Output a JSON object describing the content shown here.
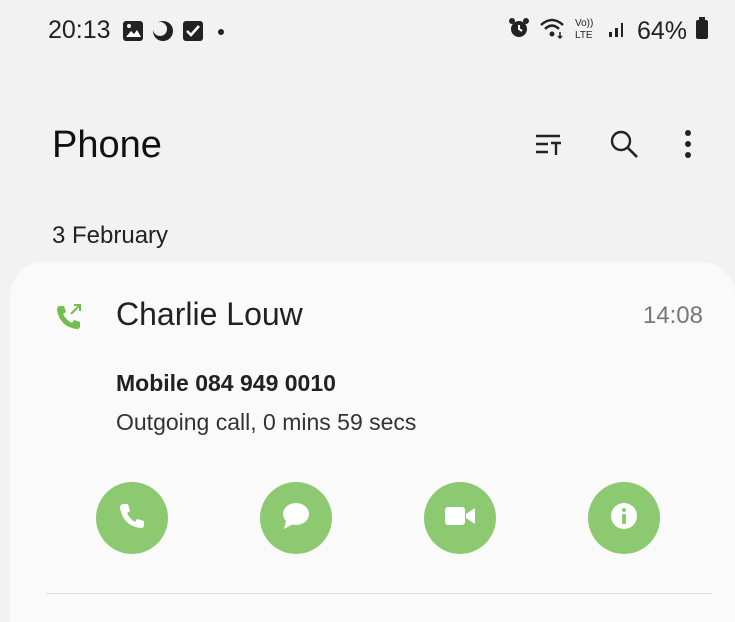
{
  "status_bar": {
    "time": "20:13",
    "battery": "64%",
    "icons_left": [
      "gallery-icon",
      "moon-icon",
      "checkbox-icon",
      "dot-icon"
    ],
    "icons_right": [
      "alarm-icon",
      "wifi-icon",
      "volte-icon",
      "signal-icon",
      "battery-icon"
    ]
  },
  "header": {
    "title": "Phone",
    "actions": [
      "filter-icon",
      "search-icon",
      "more-icon"
    ]
  },
  "log": {
    "date_header": "3 February",
    "entry": {
      "name": "Charlie Louw",
      "time": "14:08",
      "number": "Mobile 084 949 0010",
      "detail": "Outgoing call, 0 mins 59 secs",
      "call_type_icon": "outgoing-call-icon"
    },
    "actions": [
      "call-icon",
      "message-icon",
      "video-call-icon",
      "info-icon"
    ]
  },
  "colors": {
    "background": "#f2f2f2",
    "card": "#fafafa",
    "accent_green": "#8cc970",
    "outgoing_green": "#6fbf4a"
  }
}
